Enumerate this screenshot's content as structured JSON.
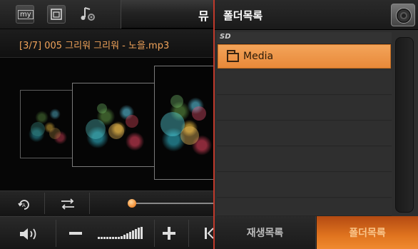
{
  "player": {
    "top_tabs": [
      {
        "label": "my",
        "icon": "my-icon"
      },
      {
        "label": "",
        "icon": "window-icon"
      },
      {
        "label": "",
        "icon": "music-settings-icon"
      }
    ],
    "partial_title": "뮤",
    "track_title": "[3/7] 005 그리워 그리워 - 노을.mp3",
    "icons": {
      "repeat": "repeat-a-icon",
      "shuffle": "shuffle-icon",
      "volume": "volume-icon",
      "minus": "minus-icon",
      "volume_level": "volume-level-icon",
      "plus": "plus-icon",
      "prev": "prev-track-icon"
    },
    "seek_progress": 0.0
  },
  "panel": {
    "title": "폴더목록",
    "storage_label": "SD",
    "folders": [
      {
        "name": "Media",
        "selected": true
      }
    ],
    "tabs": [
      {
        "label": "재생목록",
        "active": false
      },
      {
        "label": "폴더목록",
        "active": true
      }
    ]
  },
  "colors": {
    "accent": "#f08a30",
    "track_title": "#f0a35a",
    "panel_border": "#c0392b"
  }
}
